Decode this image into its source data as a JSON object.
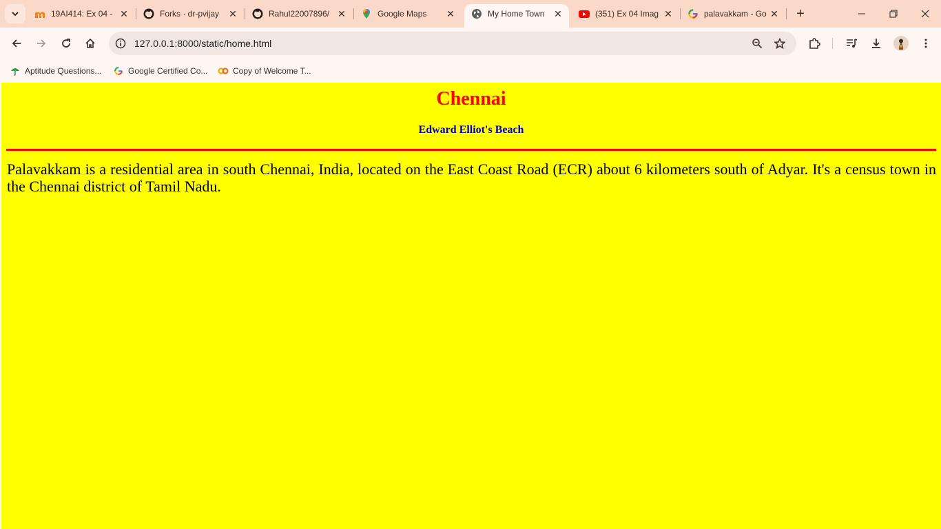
{
  "tabs": [
    {
      "title": "19AI414: Ex 04 -",
      "icon": "moodle-icon"
    },
    {
      "title": "Forks · dr-pvijay",
      "icon": "github-icon"
    },
    {
      "title": "Rahul22007896/",
      "icon": "github-icon"
    },
    {
      "title": "Google Maps",
      "icon": "maps-pin-icon"
    },
    {
      "title": "My Home Town",
      "icon": "globe-icon",
      "active": true
    },
    {
      "title": "(351) Ex 04 Imag",
      "icon": "youtube-icon"
    },
    {
      "title": "palavakkam - Go",
      "icon": "google-icon"
    }
  ],
  "address": {
    "url": "127.0.0.1:8000/static/home.html"
  },
  "bookmarks": [
    {
      "label": "Aptitude Questions...",
      "icon": "umbrella-icon"
    },
    {
      "label": "Google Certified Co...",
      "icon": "google-icon"
    },
    {
      "label": "Copy of Welcome T...",
      "icon": "colab-icon"
    }
  ],
  "page": {
    "heading": "Chennai",
    "subheading": "Edward Elliot's Beach",
    "paragraph": "Palavakkam is a residential area in south Chennai, India, located on the East Coast Road (ECR) about 6 kilometers south of Adyar. It's a census town in the Chennai district of Tamil Nadu.",
    "background_color": "#ffff00",
    "heading_color": "#ff0000",
    "subheading_color": "#0000cc",
    "rule_color": "#ff0000"
  }
}
